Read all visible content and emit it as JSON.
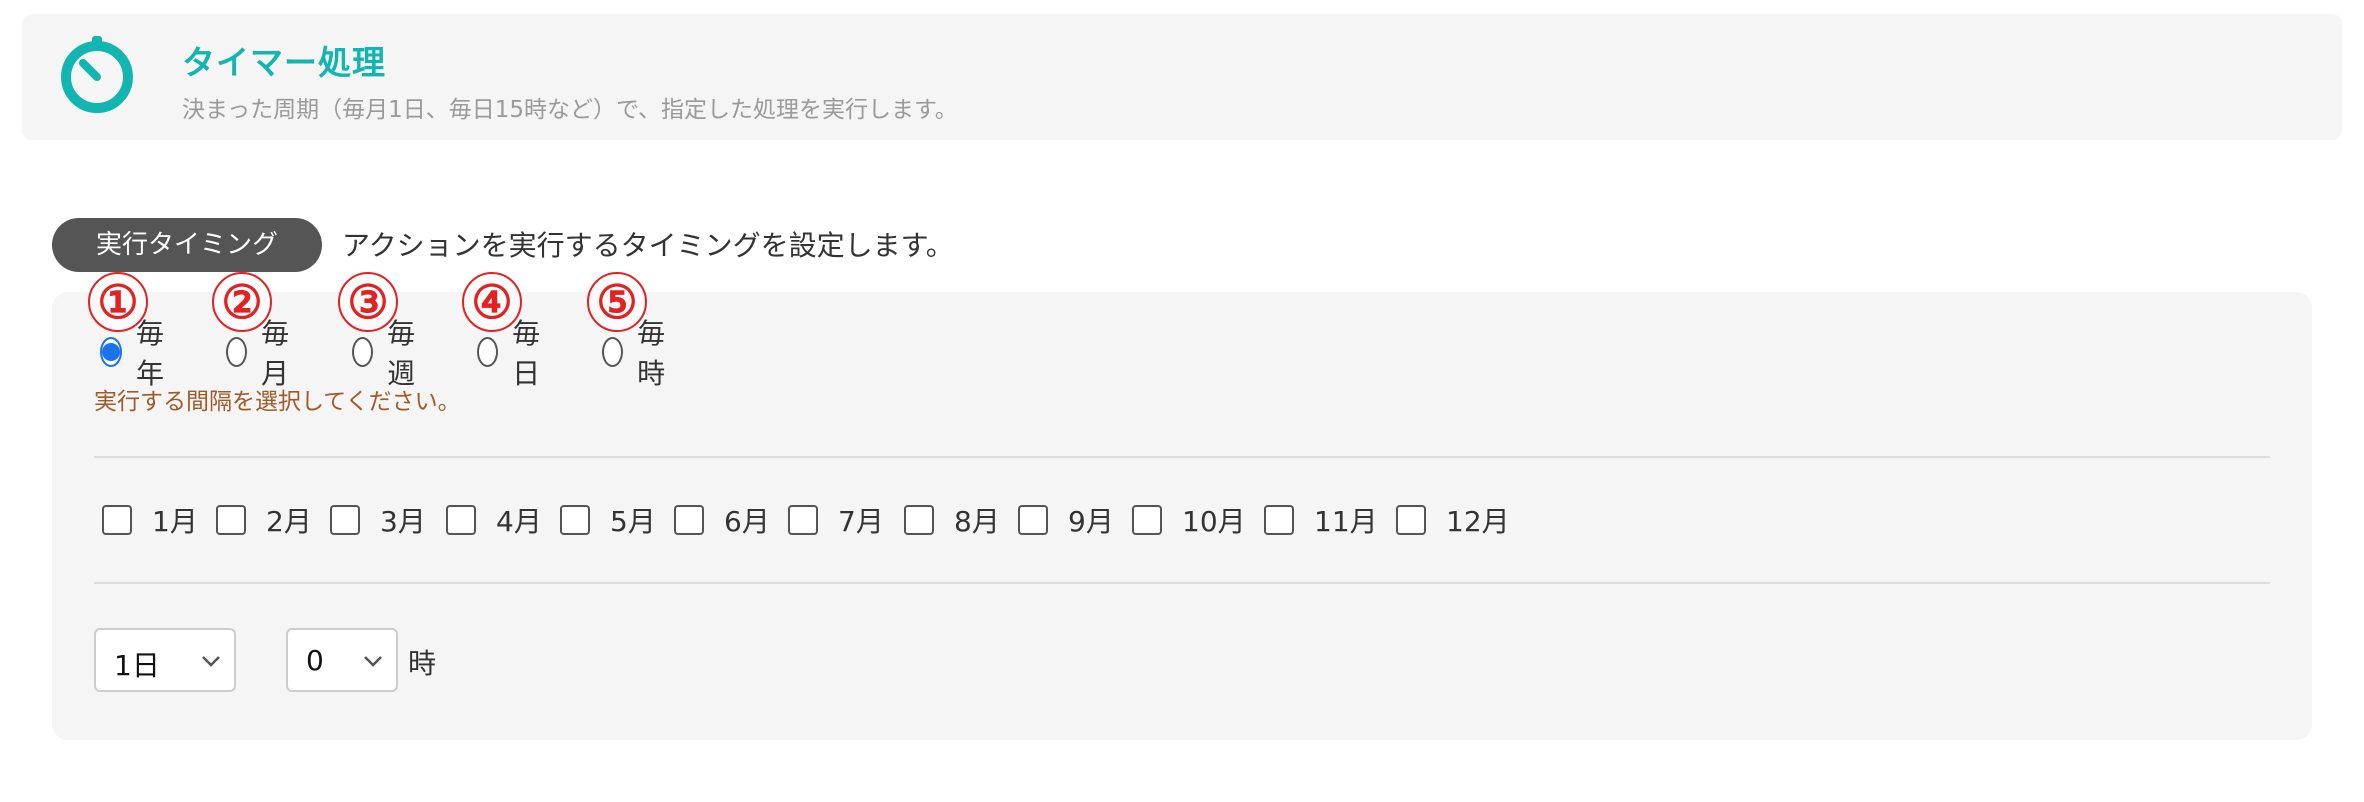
{
  "header": {
    "icon": "timer-icon",
    "title": "タイマー処理",
    "description": "決まった周期（毎月1日、毎日15時など）で、指定した処理を実行します。",
    "accent_color": "#13b5b1"
  },
  "timing": {
    "badge_label": "実行タイミング",
    "description": "アクションを実行するタイミングを設定します。"
  },
  "markers": [
    "①",
    "②",
    "③",
    "④",
    "⑤"
  ],
  "interval": {
    "options": [
      {
        "label": "毎年",
        "checked": true
      },
      {
        "label": "毎月",
        "checked": false
      },
      {
        "label": "毎週",
        "checked": false
      },
      {
        "label": "毎日",
        "checked": false
      },
      {
        "label": "毎時",
        "checked": false
      }
    ],
    "hint": "実行する間隔を選択してください。"
  },
  "months": {
    "items": [
      {
        "label": "1月",
        "checked": false
      },
      {
        "label": "2月",
        "checked": false
      },
      {
        "label": "3月",
        "checked": false
      },
      {
        "label": "4月",
        "checked": false
      },
      {
        "label": "5月",
        "checked": false
      },
      {
        "label": "6月",
        "checked": false
      },
      {
        "label": "7月",
        "checked": false
      },
      {
        "label": "8月",
        "checked": false
      },
      {
        "label": "9月",
        "checked": false
      },
      {
        "label": "10月",
        "checked": false
      },
      {
        "label": "11月",
        "checked": false
      },
      {
        "label": "12月",
        "checked": false
      }
    ]
  },
  "schedule": {
    "day_select": {
      "value": "1日"
    },
    "hour_select": {
      "value": "0"
    },
    "hour_suffix": "時"
  },
  "colors": {
    "radio_selected": "#1a73e8",
    "marker": "#e22222",
    "hint": "#a05a28"
  }
}
